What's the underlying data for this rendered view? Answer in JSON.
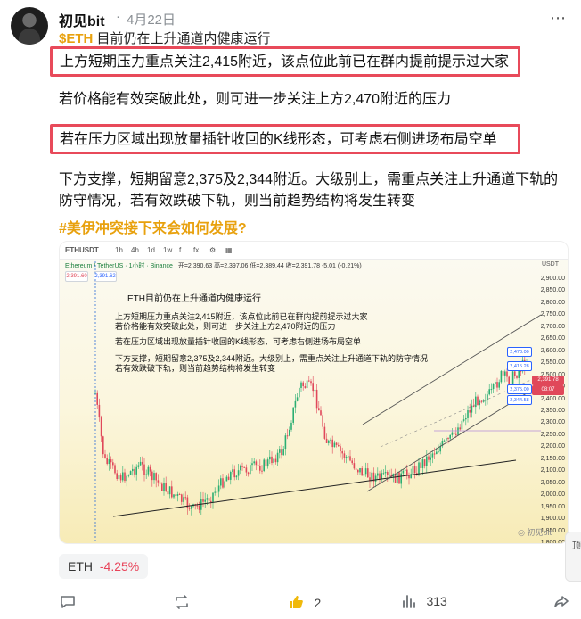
{
  "post": {
    "author": "初见bit",
    "separator": "·",
    "date": "4月22日",
    "ticker_tag": "$ETH",
    "title": "目前仍在上升通道内健康运行",
    "line1": "上方短期压力重点关注2,415附近，该点位此前已在群内提前提示过大家",
    "line2": "若价格能有效突破此处，则可进一步关注上方2,470附近的压力",
    "line3": "若在压力区域出现放量插针收回的K线形态，可考虑右侧进场布局空单",
    "para": "下方支撑，短期留意2,375及2,344附近。大级别上，需重点关注上升通道下轨的防守情况，若有效跌破下轨，则当前趋势结构将发生转变",
    "hashtag": "#美伊冲突接下来会如何发展?",
    "more_icon": "more-horizontal-icon"
  },
  "chart": {
    "top_symbol": "ETHUSDT",
    "top_items": [
      "1h",
      "4h",
      "1d",
      "1w",
      "f",
      "fx",
      "⚙",
      "▦"
    ],
    "legend": "Ethereum / TetherUS · 1小时 · Binance",
    "legend_ohlc": "开=2,390.63 高=2,397.06 低=2,389.44 收=2,391.78 -5.01 (-0.21%)",
    "box_left": "2,391.60",
    "box_right": "2,391.62",
    "currency": "USDT",
    "text_title": "ETH目前仍在上升通道内健康运行",
    "text_l1": "上方短期压力重点关注2,415附近，该点位此前已在群内提前提示过大家",
    "text_l2": "若价格能有效突破此处，则可进一步关注上方2,470附近的压力",
    "text_l3": "若在压力区域出现放量插针收回的K线形态，可考虑右侧进场布局空单",
    "text_l4": "下方支撑，短期留意2,375及2,344附近。大级别上，需重点关注上升通道下轨的防守情况",
    "text_l5": "若有效跌破下轨，则当前趋势结构将发生转变",
    "ticks": [
      "2,900.00",
      "2,850.00",
      "2,800.00",
      "2,750.00",
      "2,700.00",
      "2,650.00",
      "2,600.00",
      "2,550.00",
      "2,500.00",
      "2,450.00",
      "2,400.00",
      "2,350.00",
      "2,300.00",
      "2,250.00",
      "2,200.00",
      "2,150.00",
      "2,100.00",
      "2,050.00",
      "2,000.00",
      "1,950.00",
      "1,900.00",
      "1,850.00",
      "1,800.00"
    ],
    "tag_price": "2,391.78",
    "tag_time": "08:07",
    "level_boxes": [
      "2,470.00",
      "2,415.28",
      "2,375.00",
      "2,344.58"
    ],
    "watermark": "初见bit",
    "up_color": "#2bae72",
    "down_color": "#e0485a"
  },
  "coin": {
    "symbol": "ETH",
    "change": "-4.25%"
  },
  "actions": {
    "comment_icon": "comment-icon",
    "repost_icon": "repost-icon",
    "like_icon": "thumbs-up-icon",
    "like_count": "2",
    "views_icon": "bar-chart-icon",
    "views_count": "313",
    "share_icon": "share-icon"
  },
  "side_button": "顶"
}
